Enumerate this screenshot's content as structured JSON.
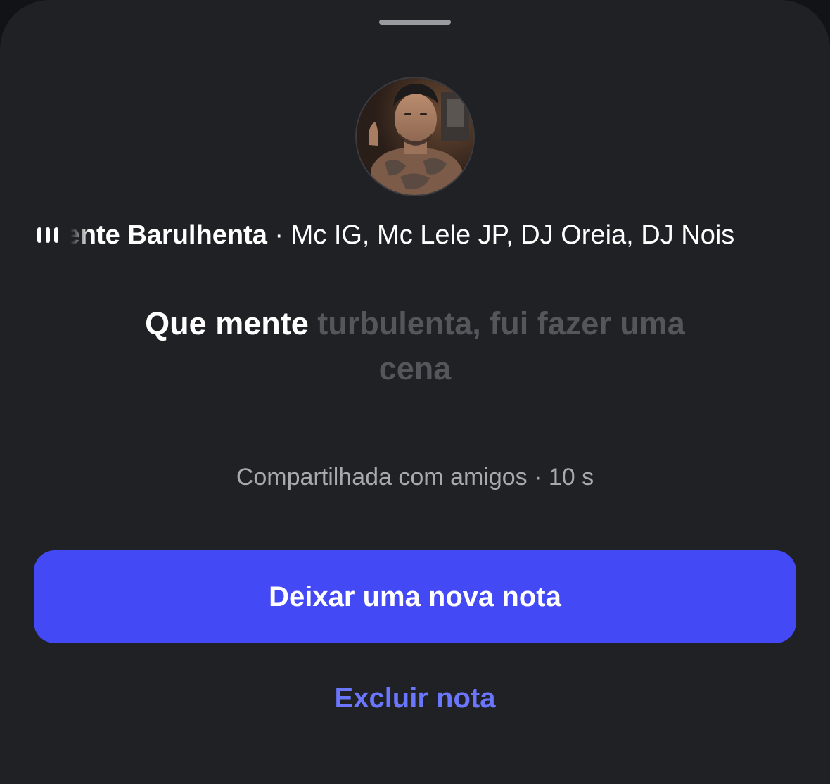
{
  "note": {
    "song": {
      "title": "Mente Barulhenta",
      "separator": " · ",
      "artists": "Mc IG, Mc Lele JP, DJ Oreia, DJ Nois"
    },
    "lyric": {
      "active": "Que mente",
      "upcoming": "turbulenta, fui fazer uma cena"
    },
    "shared_with": "Compartilhada com amigos",
    "age_separator": " · ",
    "age": "10 s"
  },
  "actions": {
    "new_note_label": "Deixar uma nova nota",
    "delete_note_label": "Excluir nota"
  },
  "colors": {
    "sheet_background": "#202125",
    "primary_button": "#4249f5",
    "link": "#6b76ff",
    "muted_lyric": "#55565c"
  },
  "icons": {
    "now_playing": "equalizer-bars-icon"
  }
}
